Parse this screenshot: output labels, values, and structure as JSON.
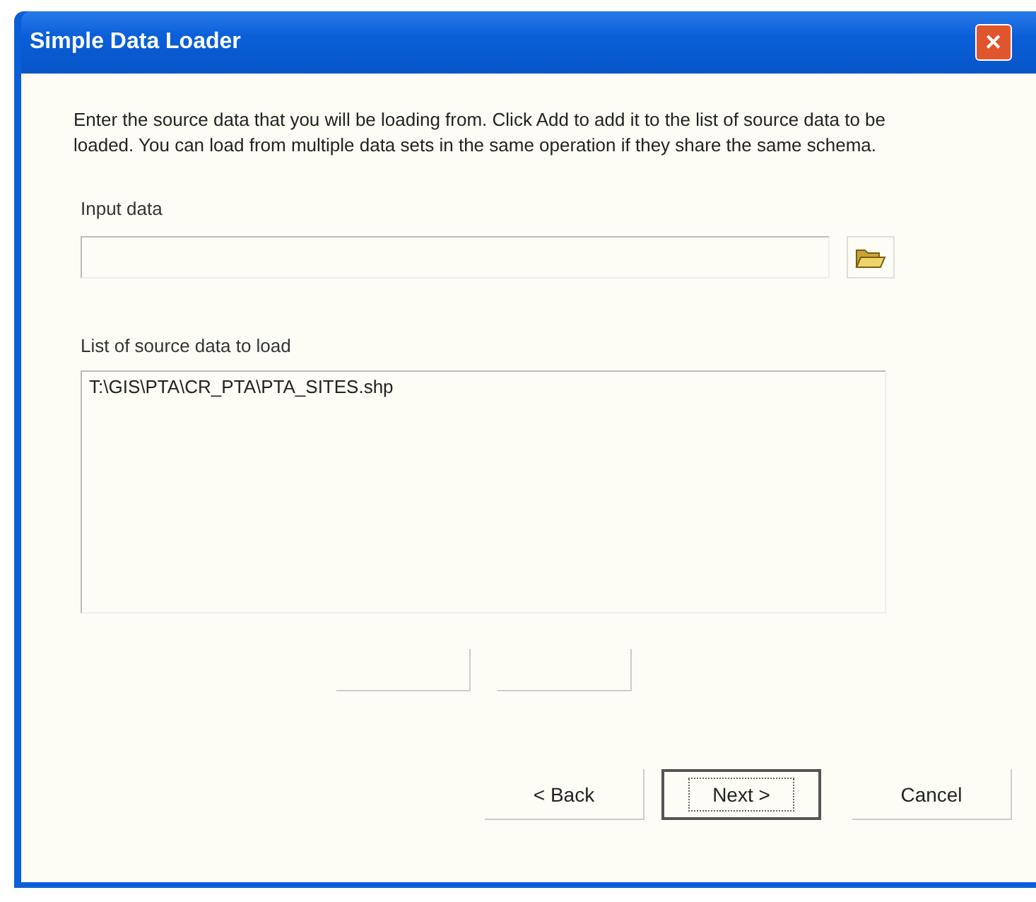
{
  "window": {
    "title": "Simple Data Loader",
    "close": "✕"
  },
  "instructions": "Enter the source data that you will be loading from. Click Add to add it to the list of source data to be loaded. You can load from multiple data sets in the same operation if they share the same schema.",
  "input_label": "Input data",
  "list_label": "List of source data to load",
  "source_list": [
    {
      "path": "T:\\GIS\\PTA\\CR_PTA\\PTA_SITES.shp",
      "selected": false
    }
  ],
  "buttons": [
    {
      "label": "< Back",
      "focused": false
    },
    {
      "label": "Next >",
      "focused": true
    },
    {
      "label": "Cancel",
      "focused": false
    }
  ]
}
